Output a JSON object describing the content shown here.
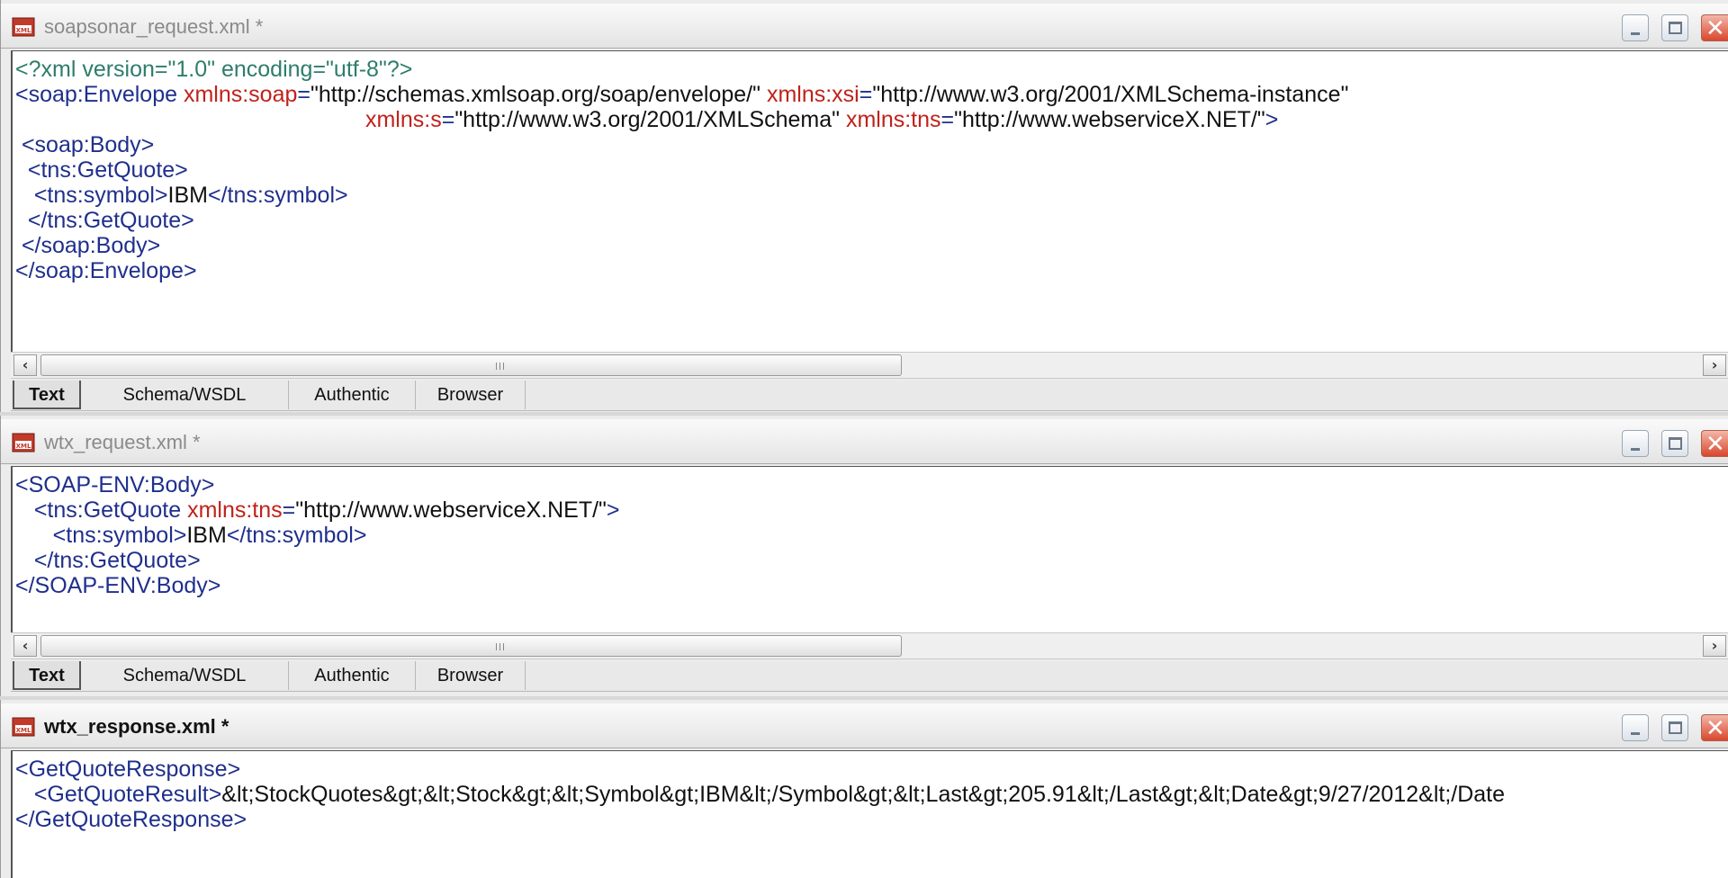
{
  "windows": [
    {
      "title": "soapsonar_request.xml *",
      "lines": [
        [
          [
            "decl",
            "<?xml version=\"1.0\" encoding=\"utf-8\"?>"
          ]
        ],
        [
          [
            "tag",
            "<soap:Envelope "
          ],
          [
            "attr",
            "xmlns:soap"
          ],
          [
            "tag",
            "="
          ],
          [
            "text",
            "\"http://schemas.xmlsoap.org/soap/envelope/\" "
          ],
          [
            "attr",
            "xmlns:xsi"
          ],
          [
            "tag",
            "="
          ],
          [
            "text",
            "\"http://www.w3.org/2001/XMLSchema-instance\""
          ]
        ],
        [
          [
            "text",
            "                                                        "
          ],
          [
            "attr",
            "xmlns:s"
          ],
          [
            "tag",
            "="
          ],
          [
            "text",
            "\"http://www.w3.org/2001/XMLSchema\" "
          ],
          [
            "attr",
            "xmlns:tns"
          ],
          [
            "tag",
            "="
          ],
          [
            "text",
            "\"http://www.webserviceX.NET/\""
          ],
          [
            "tag",
            ">"
          ]
        ],
        [
          [
            "tag",
            " <soap:Body>"
          ]
        ],
        [
          [
            "tag",
            "  <tns:GetQuote>"
          ]
        ],
        [
          [
            "tag",
            "   <tns:symbol>"
          ],
          [
            "text",
            "IBM"
          ],
          [
            "tag",
            "</tns:symbol>"
          ]
        ],
        [
          [
            "tag",
            "  </tns:GetQuote>"
          ]
        ],
        [
          [
            "tag",
            " </soap:Body>"
          ]
        ],
        [
          [
            "tag",
            "</soap:Envelope>"
          ]
        ]
      ],
      "tabs": [
        "Text",
        "Schema/WSDL",
        "Authentic",
        "Browser"
      ],
      "active_tab": "Text"
    },
    {
      "title": "wtx_request.xml *",
      "lines": [
        [
          [
            "tag",
            "<SOAP-ENV:Body>"
          ]
        ],
        [
          [
            "tag",
            "   <tns:GetQuote "
          ],
          [
            "attr",
            "xmlns:tns"
          ],
          [
            "tag",
            "="
          ],
          [
            "text",
            "\"http://www.webserviceX.NET/\""
          ],
          [
            "tag",
            ">"
          ]
        ],
        [
          [
            "tag",
            "      <tns:symbol>"
          ],
          [
            "text",
            "IBM"
          ],
          [
            "tag",
            "</tns:symbol>"
          ]
        ],
        [
          [
            "tag",
            "   </tns:GetQuote>"
          ]
        ],
        [
          [
            "tag",
            "</SOAP-ENV:Body>"
          ]
        ]
      ],
      "tabs": [
        "Text",
        "Schema/WSDL",
        "Authentic",
        "Browser"
      ],
      "active_tab": "Text"
    },
    {
      "title": "wtx_response.xml *",
      "lines": [
        [
          [
            "tag",
            "<GetQuoteResponse>"
          ]
        ],
        [
          [
            "tag",
            "   <GetQuoteResult>"
          ],
          [
            "text",
            "&lt;StockQuotes&gt;&lt;Stock&gt;&lt;Symbol&gt;IBM&lt;/Symbol&gt;&lt;Last&gt;205.91&lt;/Last&gt;&lt;Date&gt;9/27/2012&lt;/Date"
          ]
        ],
        [
          [
            "tag",
            "</GetQuoteResponse>"
          ]
        ]
      ]
    }
  ],
  "icons": {
    "file": "xml-file-icon",
    "minimize": "minimize-icon",
    "maximize": "maximize-icon",
    "close": "close-icon",
    "scroll_left": "arrow-left-icon",
    "scroll_right": "arrow-right-icon"
  },
  "colors": {
    "tag": "#1f2f8c",
    "attr": "#c0221a",
    "text": "#111111",
    "decl": "#2e7d6b"
  }
}
